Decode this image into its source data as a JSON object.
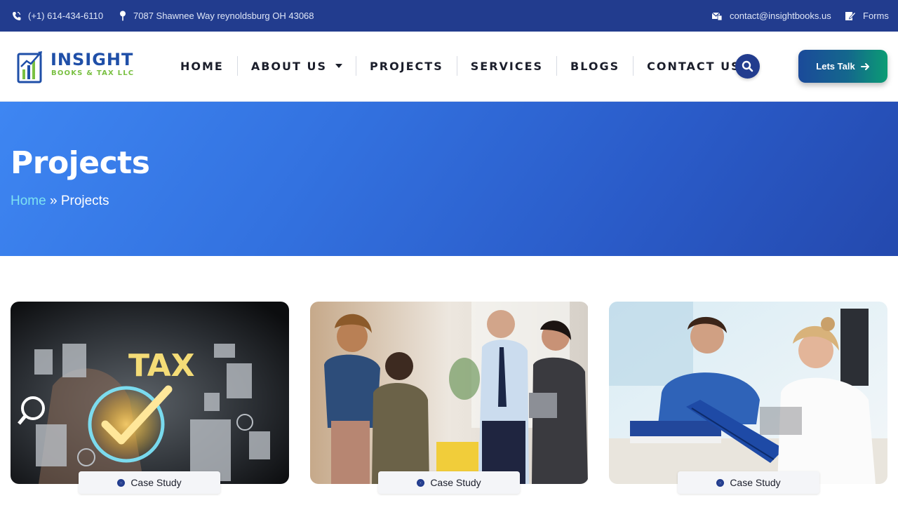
{
  "topbar": {
    "phone": "(+1) 614-434-6110",
    "address": "7087 Shawnee Way reynoldsburg OH 43068",
    "email": "contact@insightbooks.us",
    "forms": "Forms"
  },
  "logo": {
    "name": "INSIGHT",
    "tagline": "BOOKS & TAX LLC"
  },
  "nav": {
    "home": "HOME",
    "about": "ABOUT US",
    "projects": "PROJECTS",
    "services": "SERVICES",
    "blogs": "BLOGS",
    "contact": "CONTACT US"
  },
  "cta": {
    "label": "Lets Talk"
  },
  "hero": {
    "title": "Projects",
    "crumb_home": "Home",
    "crumb_sep": "»",
    "crumb_current": "Projects"
  },
  "cards": [
    {
      "badge": "Case Study",
      "image_text": "TAX"
    },
    {
      "badge": "Case Study"
    },
    {
      "badge": "Case Study"
    }
  ],
  "colors": {
    "brand_dark": "#223c8e",
    "hero_start": "#3e86f2",
    "hero_end": "#2449ae",
    "crumb_link": "#7de2f2",
    "cta_start": "#1b4a9a",
    "cta_end": "#0b9c74"
  },
  "icons": [
    "phone-icon",
    "location-pin-icon",
    "email-icon",
    "forms-icon",
    "search-icon",
    "arrow-right-icon",
    "caret-down-icon"
  ]
}
